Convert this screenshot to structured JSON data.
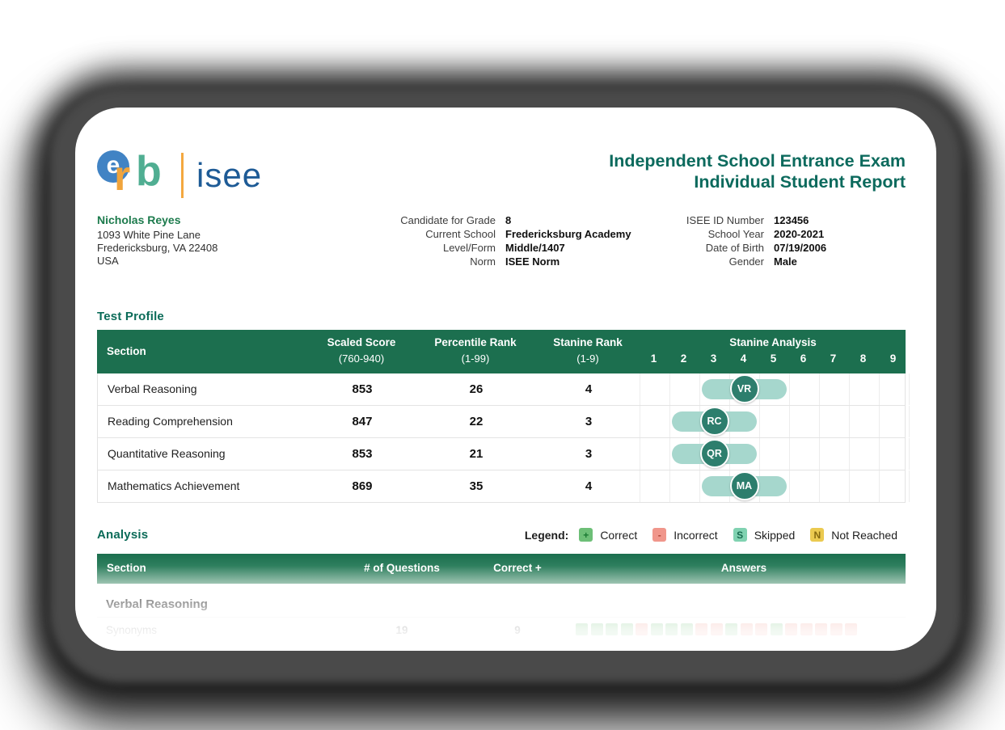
{
  "brand": {
    "logo_letters": [
      "e",
      "r",
      "b"
    ],
    "logo_product": "isee",
    "colors": {
      "e_bg": "#4183c4",
      "r": "#f0a43c",
      "b": "#50ae92",
      "divider": "#f4a83f",
      "isee": "#1e5b96"
    }
  },
  "title": {
    "line1": "Independent School Entrance Exam",
    "line2": "Individual Student Report",
    "color": "#0c6a5d"
  },
  "student": {
    "name": "Nicholas Reyes",
    "address_lines": [
      "1093 White Pine Lane",
      "Fredericksburg, VA 22408",
      "USA"
    ]
  },
  "info_mid": [
    {
      "label": "Candidate for Grade",
      "value": "8"
    },
    {
      "label": "Current School",
      "value": "Fredericksburg Academy"
    },
    {
      "label": "Level/Form",
      "value": "Middle/1407"
    },
    {
      "label": "Norm",
      "value": "ISEE Norm"
    }
  ],
  "info_right": [
    {
      "label": "ISEE ID Number",
      "value": "123456"
    },
    {
      "label": "School Year",
      "value": "2020-2021"
    },
    {
      "label": "Date of Birth",
      "value": "07/19/2006"
    },
    {
      "label": "Gender",
      "value": "Male"
    }
  ],
  "test_profile": {
    "heading": "Test Profile",
    "header": {
      "section": "Section",
      "scaled_score": "Scaled Score",
      "scaled_score_range": "(760-940)",
      "percentile": "Percentile Rank",
      "percentile_range": "(1-99)",
      "stanine": "Stanine Rank",
      "stanine_range": "(1-9)",
      "stanine_analysis": "Stanine Analysis",
      "stanine_numbers": [
        "1",
        "2",
        "3",
        "4",
        "5",
        "6",
        "7",
        "8",
        "9"
      ]
    },
    "header_bg": "#1c6f4f",
    "band_color": "#a6d7cd",
    "marker_color": "#2d7e6d",
    "rows": [
      {
        "section": "Verbal Reasoning",
        "scaled_score": "853",
        "percentile": "26",
        "stanine": "4",
        "code": "VR",
        "band_start": 3,
        "band_end": 5,
        "marker": 4
      },
      {
        "section": "Reading Comprehension",
        "scaled_score": "847",
        "percentile": "22",
        "stanine": "3",
        "code": "RC",
        "band_start": 2,
        "band_end": 4,
        "marker": 3
      },
      {
        "section": "Quantitative Reasoning",
        "scaled_score": "853",
        "percentile": "21",
        "stanine": "3",
        "code": "QR",
        "band_start": 2,
        "band_end": 4,
        "marker": 3
      },
      {
        "section": "Mathematics Achievement",
        "scaled_score": "869",
        "percentile": "35",
        "stanine": "4",
        "code": "MA",
        "band_start": 3,
        "band_end": 5,
        "marker": 4
      }
    ]
  },
  "analysis": {
    "heading": "Analysis",
    "legend_label": "Legend:",
    "legend_items": [
      {
        "glyph": "+",
        "label": "Correct",
        "bg": "#6dbf77",
        "fg": "#1a7a33"
      },
      {
        "glyph": "-",
        "label": "Incorrect",
        "bg": "#f0968b",
        "fg": "#ae4437"
      },
      {
        "glyph": "S",
        "label": "Skipped",
        "bg": "#80d2b1",
        "fg": "#176b4f"
      },
      {
        "glyph": "N",
        "label": "Not Reached",
        "bg": "#ebca50",
        "fg": "#86690f"
      }
    ],
    "header": {
      "section": "Section",
      "num_questions": "# of Questions",
      "correct": "Correct +",
      "answers": "Answers"
    },
    "subsection": "Verbal Reasoning",
    "faded_row": {
      "section": "Synonyms",
      "num_questions": "19",
      "correct": "9",
      "answer_marks": [
        "+",
        "+",
        "+",
        "+",
        "-",
        "+",
        "+",
        "+",
        "-",
        "-",
        "+",
        "-",
        "-",
        "+",
        "-",
        "-",
        "-",
        "-",
        "-"
      ]
    }
  }
}
